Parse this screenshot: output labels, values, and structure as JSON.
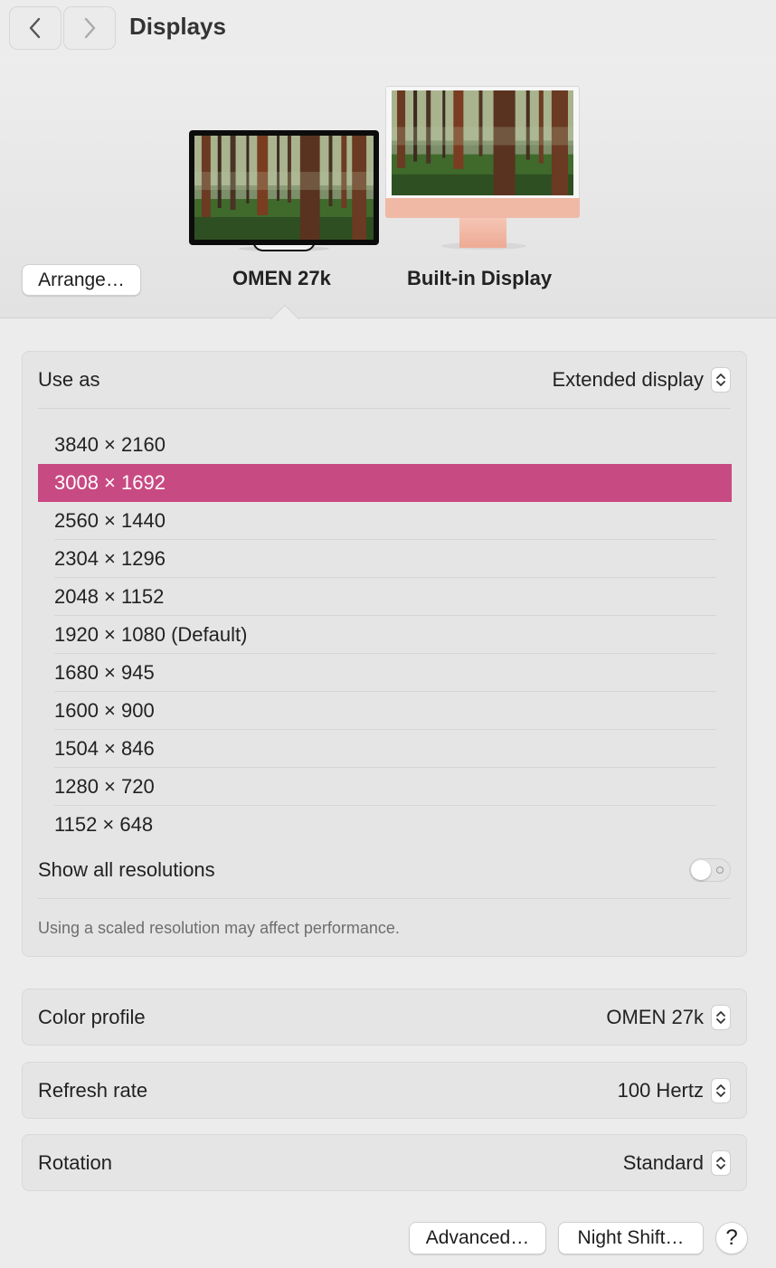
{
  "header": {
    "title": "Displays",
    "back_icon": "chevron-left-icon",
    "forward_icon": "chevron-right-icon"
  },
  "arrange": {
    "label": "Arrange…"
  },
  "displays": [
    {
      "name": "OMEN 27k",
      "selected": true
    },
    {
      "name": "Built-in Display",
      "selected": false
    }
  ],
  "settings": {
    "use_as": {
      "label": "Use as",
      "value": "Extended display"
    },
    "resolutions": [
      "3840 × 2160",
      "3008 × 1692",
      "2560 × 1440",
      "2304 × 1296",
      "2048 × 1152",
      "1920 × 1080 (Default)",
      "1680 × 945",
      "1600 × 900",
      "1504 × 846",
      "1280 × 720",
      "1152 × 648"
    ],
    "selected_resolution": "3008 × 1692",
    "show_all": {
      "label": "Show all resolutions",
      "on": false
    },
    "footnote": "Using a scaled resolution may affect performance."
  },
  "color_profile": {
    "label": "Color profile",
    "value": "OMEN 27k"
  },
  "refresh_rate": {
    "label": "Refresh rate",
    "value": "100 Hertz"
  },
  "rotation": {
    "label": "Rotation",
    "value": "Standard"
  },
  "buttons": {
    "advanced": "Advanced…",
    "night_shift": "Night Shift…",
    "help": "?"
  },
  "colors": {
    "selection": "#c84a83",
    "imac_chin": "#f0b9a6",
    "window_bg": "#ececec"
  }
}
